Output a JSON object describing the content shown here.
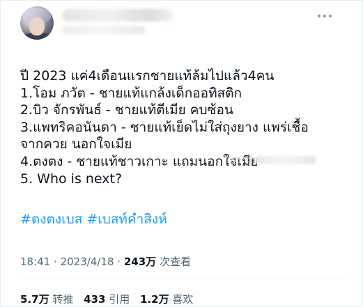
{
  "tweet": {
    "lines": [
      "ปี 2023 แค่4เดือนแรกชายแท้ล้มไปแล้ว4คน",
      "1.โอม ภวัต - ชายแท้แกล้งเด็กออทิสติก",
      "2.บิว จักรพันธ์ - ชายแท้ตีเมีย คบซ้อน",
      "3.แพทริคอนันดา - ชายแท้เย็ดไม่ใส่ถุงยาง แพร่เชื้อ",
      "จากควย นอกใจเมีย",
      "4.ตงตง - ชายแท้ชาวเกาะ แถมนอกใจเมีย",
      "5. Who is next?"
    ],
    "hashtags": [
      "#ตงตงเบส",
      "#เบสท์คำสิงห์"
    ]
  },
  "meta": {
    "time": "18:41",
    "separator": "·",
    "date": "2023/4/18",
    "views_count": "243万",
    "views_label": "次查看"
  },
  "stats": {
    "retweets_count": "5.7万",
    "retweets_label": "转推",
    "quotes_count": "433",
    "quotes_label": "引用",
    "likes_count": "1.2万",
    "likes_label": "喜欢"
  },
  "watermark": {
    "prefix": "@"
  },
  "icons": {
    "more": "more-horizontal-icon",
    "watermark": "weibo-logo-icon"
  },
  "colors": {
    "hashtag": "#1d9bf0",
    "secondary_text": "#536471",
    "primary_text": "#0f1419"
  }
}
